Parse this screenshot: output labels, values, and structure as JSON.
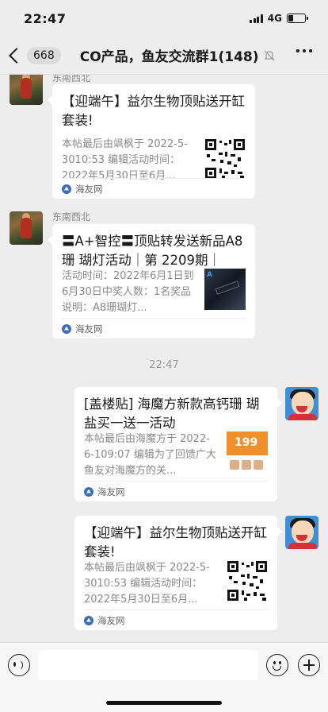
{
  "status_bar": {
    "time": "22:47",
    "network": "4G"
  },
  "nav": {
    "unread_count": "668",
    "title": "CO产品，鱼友交流群1(148)"
  },
  "messages": [
    {
      "side": "left",
      "sender": "东南西北",
      "title": "【迎端午】益尔生物顶贴送开缸套装!",
      "desc": "本帖最后由飒枫于 2022-5-3010:53 编辑活动时间：2022年5月30日至6月...",
      "thumb": "qr-code-image",
      "source": "海友网"
    },
    {
      "side": "left",
      "sender": "东南西北",
      "title": "〓A+智控〓顶贴转发送新品A8珊 瑚灯活动｜第 2209期｜",
      "desc": "活动时间：2022年6月1日到6月30日中奖人数：1名奖品说明：A8珊瑚灯...",
      "thumb": "aquarium-light-image",
      "thumb_label": "A",
      "source": "海友网"
    },
    {
      "side": "right",
      "title": "[盖楼贴] 海魔方新款高钙珊 瑚盐买一送一活动",
      "desc": "本帖最后由海魔方于 2022-6-109:07 编辑为了回馈广大鱼友对海魔方的关...",
      "thumb": "promo-ad-image",
      "thumb_label": "199",
      "source": "海友网"
    },
    {
      "side": "right",
      "title": "【迎端午】益尔生物顶贴送开缸套装!",
      "desc": "本帖最后由飒枫于 2022-5-3010:53 编辑活动时间：2022年5月30日至6月...",
      "thumb": "qr-code-image",
      "source": "海友网"
    }
  ],
  "timestamp": "22:47",
  "input": {
    "placeholder": ""
  }
}
